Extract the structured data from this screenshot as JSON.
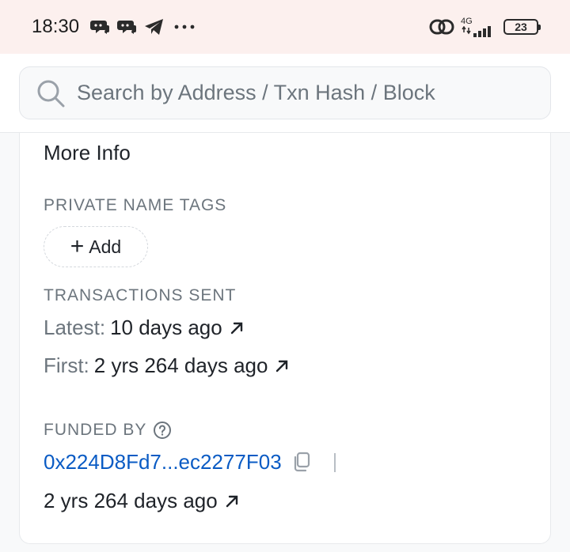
{
  "status_bar": {
    "time": "18:30",
    "network_type": "4G",
    "battery_level": "23",
    "icons": [
      "chat-bubble-icon",
      "chat-bubble-icon",
      "telegram-icon",
      "more-dots-icon"
    ]
  },
  "search": {
    "placeholder": "Search by Address / Txn Hash / Block / Token / Domain Name"
  },
  "more_info": {
    "title": "More Info",
    "private_name_tags": {
      "label": "PRIVATE NAME TAGS",
      "add_label": "Add"
    },
    "transactions_sent": {
      "label": "TRANSACTIONS SENT",
      "latest_key": "Latest:",
      "latest_value": "10 days ago",
      "first_key": "First:",
      "first_value": "2 yrs 264 days ago"
    },
    "funded_by": {
      "label": "FUNDED BY",
      "address": "0x224D8Fd7...ec2277F03",
      "age": "2 yrs 264 days ago"
    }
  },
  "colors": {
    "status_bar_bg": "#fcf0ee",
    "link": "#0a5bc4",
    "muted_text": "#6c757d",
    "primary_text": "#1f2329"
  }
}
